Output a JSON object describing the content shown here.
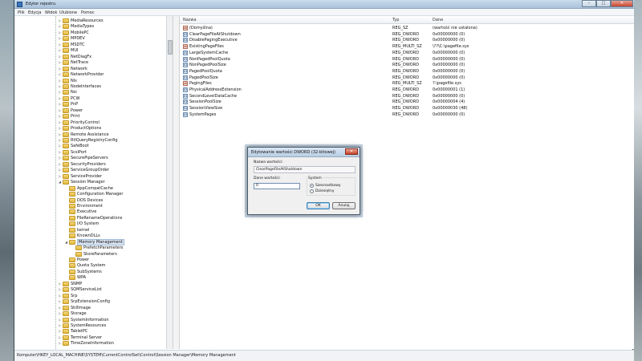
{
  "app": {
    "title": "Edytor rejestru"
  },
  "window_buttons": {
    "minimize": "–",
    "maximize": "□",
    "close": "✕"
  },
  "menu": [
    "Plik",
    "Edycja",
    "Widok",
    "Ulubione",
    "Pomoc"
  ],
  "tree": {
    "items_lvl1_top": [
      "MediaResources",
      "MediaTypes",
      "MobilePC",
      "MPDEV",
      "MSDTC",
      "MUI",
      "NetDiagFx",
      "NetTrace",
      "Network",
      "NetworkProvider",
      "Nls",
      "NodeInterfaces",
      "Nsi",
      "PCW",
      "PnP",
      "Power",
      "Print",
      "PriorityControl",
      "ProductOptions",
      "Remote Assistance",
      "RtlQueryRegistryConfig",
      "SafeBoot",
      "ScsiPort",
      "SecurePipeServers",
      "SecurityProviders",
      "ServiceGroupOrder",
      "ServiceProvider",
      "Session Manager"
    ],
    "items_lvl2_a": [
      "AppCompatCache",
      "Configuration Manager",
      "DOS Devices",
      "Environment",
      "Executive",
      "FileRenameOperations",
      "I/O System",
      "kernel",
      "KnownDLLs"
    ],
    "selected": "Memory Management",
    "items_lvl3": [
      "PrefetchParameters",
      "StoreParameters"
    ],
    "items_lvl2_b": [
      "Power",
      "Quota System",
      "SubSystems",
      "WPA"
    ],
    "items_lvl1_bottom": [
      "SNMP",
      "SQMServiceList",
      "Srp",
      "SrpExtensionConfig",
      "StillImage",
      "Storage",
      "SystemInformation",
      "SystemResources",
      "TabletPC",
      "Terminal Server",
      "TimeZoneInformation"
    ]
  },
  "columns": {
    "name": "Nazwa",
    "type": "Typ",
    "data": "Dane"
  },
  "values": [
    {
      "icon": "ab",
      "name": "(Domyślna)",
      "type": "REG_SZ",
      "data": "(wartość nie ustalona)"
    },
    {
      "icon": "01",
      "name": "ClearPageFileAtShutdown",
      "type": "REG_DWORD",
      "data": "0x00000000 (0)"
    },
    {
      "icon": "01",
      "name": "DisablePagingExecutive",
      "type": "REG_DWORD",
      "data": "0x00000000 (0)"
    },
    {
      "icon": "ab",
      "name": "ExistingPageFiles",
      "type": "REG_MULTI_SZ",
      "data": "\\??\\C:\\pagefile.sys"
    },
    {
      "icon": "01",
      "name": "LargeSystemCache",
      "type": "REG_DWORD",
      "data": "0x00000000 (0)"
    },
    {
      "icon": "01",
      "name": "NonPagedPoolQuota",
      "type": "REG_DWORD",
      "data": "0x00000000 (0)"
    },
    {
      "icon": "01",
      "name": "NonPagedPoolSize",
      "type": "REG_DWORD",
      "data": "0x00000000 (0)"
    },
    {
      "icon": "01",
      "name": "PagedPoolQuota",
      "type": "REG_DWORD",
      "data": "0x00000000 (0)"
    },
    {
      "icon": "01",
      "name": "PagedPoolSize",
      "type": "REG_DWORD",
      "data": "0x00000000 (0)"
    },
    {
      "icon": "ab",
      "name": "PagingFiles",
      "type": "REG_MULTI_SZ",
      "data": "?:\\pagefile.sys"
    },
    {
      "icon": "01",
      "name": "PhysicalAddressExtension",
      "type": "REG_DWORD",
      "data": "0x00000001 (1)"
    },
    {
      "icon": "01",
      "name": "SecondLevelDataCache",
      "type": "REG_DWORD",
      "data": "0x00000000 (0)"
    },
    {
      "icon": "01",
      "name": "SessionPoolSize",
      "type": "REG_DWORD",
      "data": "0x00000004 (4)"
    },
    {
      "icon": "01",
      "name": "SessionViewSize",
      "type": "REG_DWORD",
      "data": "0x00000030 (48)"
    },
    {
      "icon": "01",
      "name": "SystemPages",
      "type": "REG_DWORD",
      "data": "0x00000000 (0)"
    }
  ],
  "status": {
    "path": "Komputer\\HKEY_LOCAL_MACHINE\\SYSTEM\\CurrentControlSet\\Control\\Session Manager\\Memory Management"
  },
  "dialog": {
    "title": "Edytowanie wartości DWORD (32-bitowej)",
    "close": "✕",
    "name_label": "Nazwa wartości:",
    "name_value": "ClearPageFileAtShutdown",
    "data_label": "Dane wartości:",
    "data_value": "0",
    "system_label": "System",
    "radio_hex": "Szesnastkowy",
    "radio_dec": "Dziesiętny",
    "selected_base": "hex",
    "ok": "OK",
    "cancel": "Anuluj"
  }
}
